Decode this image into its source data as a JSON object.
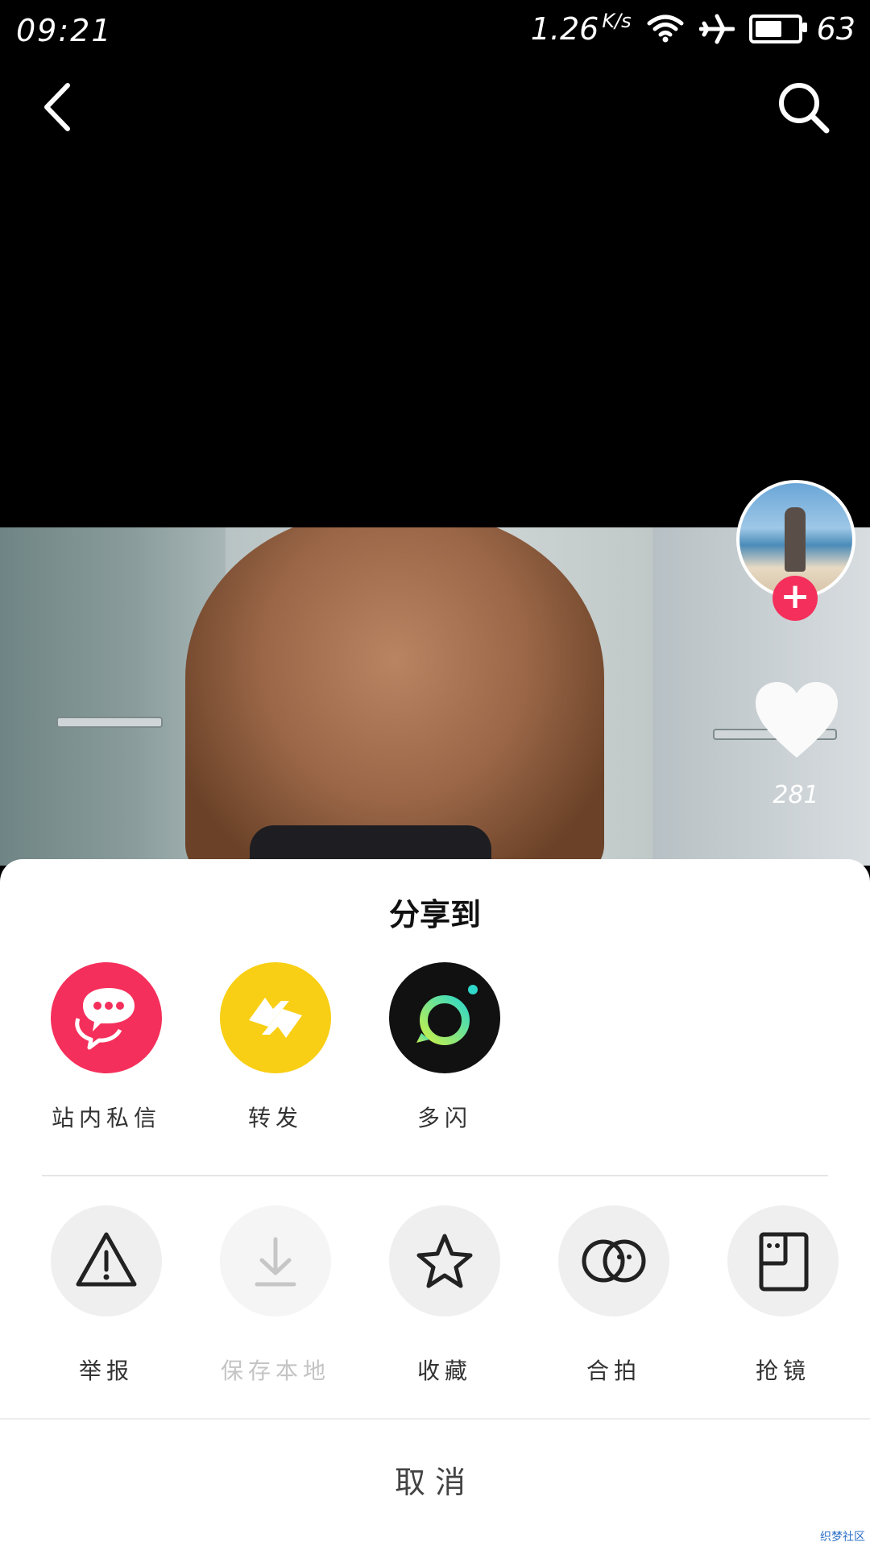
{
  "status_bar": {
    "time": "09:21",
    "net_speed": "1.26",
    "net_speed_unit": "K/s",
    "battery_level": "63"
  },
  "video": {
    "like_count": "281"
  },
  "share_sheet": {
    "title": "分享到",
    "share_targets": [
      {
        "label": "站内私信",
        "color": "#f52f5b",
        "icon": "chat-bubbles-icon"
      },
      {
        "label": "转发",
        "color": "#f8cf14",
        "icon": "repost-arrows-icon"
      },
      {
        "label": "多闪",
        "color": "#111111",
        "icon": "duoshan-logo-icon"
      }
    ],
    "actions": [
      {
        "label": "举报",
        "icon": "warning-icon",
        "enabled": true
      },
      {
        "label": "保存本地",
        "icon": "download-icon",
        "enabled": false
      },
      {
        "label": "收藏",
        "icon": "star-icon",
        "enabled": true
      },
      {
        "label": "合拍",
        "icon": "duet-icon",
        "enabled": true
      },
      {
        "label": "抢镜",
        "icon": "react-icon",
        "enabled": true
      }
    ],
    "cancel_label": "取消"
  },
  "watermark": "织梦社区",
  "colors": {
    "accent_red": "#f52f5b",
    "repost_yellow": "#f8cf14"
  }
}
